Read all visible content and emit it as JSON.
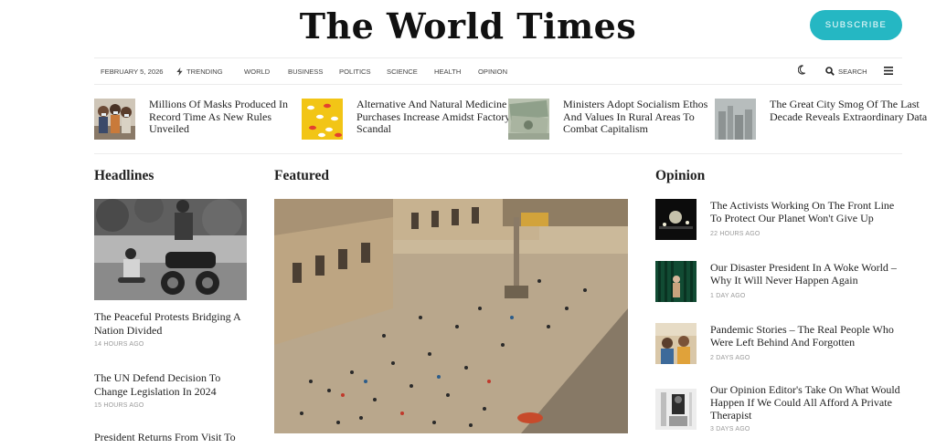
{
  "masthead": {
    "logo": "The World Times",
    "subscribe_label": "SUBSCRIBE"
  },
  "nav": {
    "date": "FEBRUARY 5, 2026",
    "trending_label": "TRENDING",
    "links": [
      "WORLD",
      "BUSINESS",
      "POLITICS",
      "SCIENCE",
      "HEALTH",
      "OPINION"
    ],
    "search_label": "SEARCH",
    "icons": [
      "bolt-icon",
      "moon-icon",
      "search-icon",
      "menu-icon"
    ]
  },
  "trending": [
    {
      "title": "Millions Of Masks Produced In Record Time As New Rules Unveiled",
      "thumb": "masked-family"
    },
    {
      "title": "Alternative And Natural Medicine Purchases Increase Amidst Factory Scandal",
      "thumb": "pills-on-yellow"
    },
    {
      "title": "Ministers Adopt Socialism Ethos And Values In Rural Areas To Combat Capitalism",
      "thumb": "dollar-bills"
    },
    {
      "title": "The Great City Smog Of The Last Decade Reveals Extraordinary Data",
      "thumb": "smoggy-skyline"
    }
  ],
  "sections": {
    "headlines": "Headlines",
    "featured": "Featured",
    "opinion": "Opinion"
  },
  "headlines": [
    {
      "title": "The Peaceful Protests Bridging A Nation Divided",
      "time": "14 HOURS AGO"
    },
    {
      "title": "The UN Defend Decision To Change Legislation In 2024",
      "time": "15 HOURS AGO"
    },
    {
      "title": "President Returns From Visit To",
      "time": ""
    }
  ],
  "opinion": [
    {
      "title": "The Activists Working On The Front Line To Protect Our Planet Won't Give Up",
      "time": "22 HOURS AGO"
    },
    {
      "title": "Our Disaster President In A Woke World – Why It Will Never Happen Again",
      "time": "1 DAY AGO"
    },
    {
      "title": "Pandemic Stories – The Real People Who Were Left Behind And Forgotten",
      "time": "2 DAYS AGO"
    },
    {
      "title": "Our Opinion Editor's Take On What Would Happen If We Could All Afford A Private Therapist",
      "time": "3 DAYS AGO"
    }
  ],
  "colors": {
    "accent": "#25b7c3",
    "text": "#222222",
    "meta": "#999999",
    "rule": "#ececec"
  }
}
